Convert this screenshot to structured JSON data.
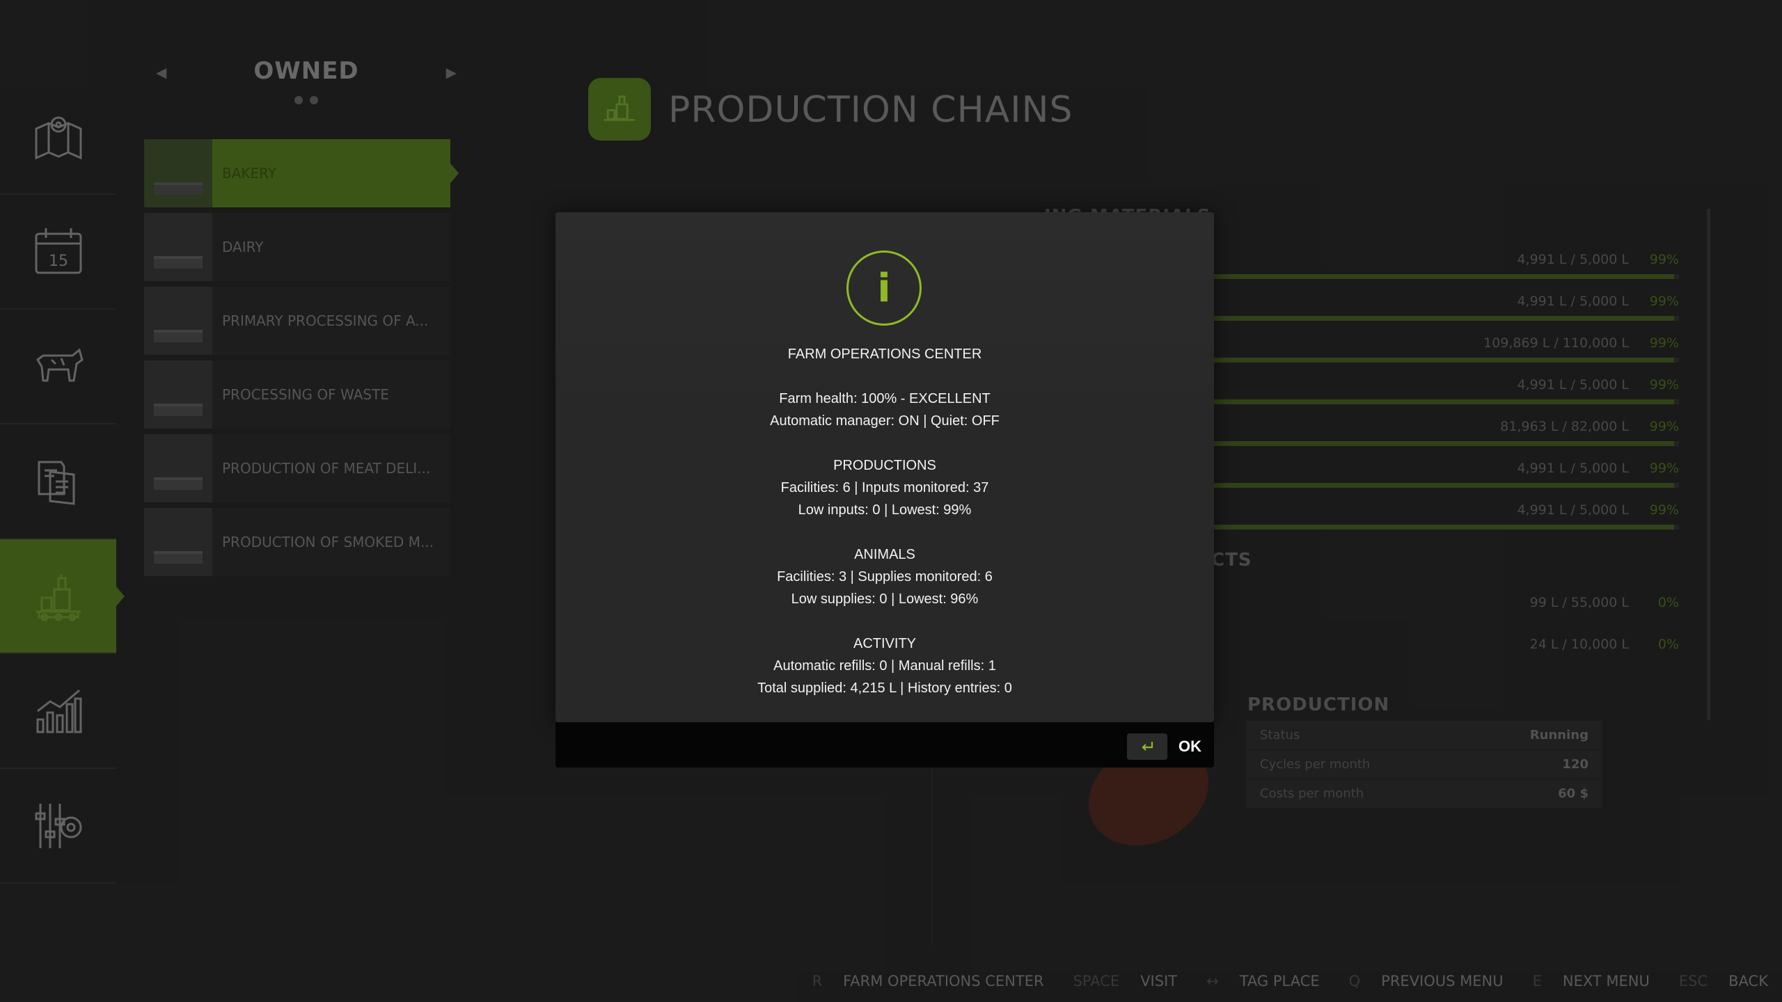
{
  "sidebar": {
    "items": [
      {
        "icon": "map-pin-icon",
        "active": false
      },
      {
        "icon": "calendar-icon",
        "active": false
      },
      {
        "icon": "cow-icon",
        "active": false
      },
      {
        "icon": "contracts-icon",
        "active": false
      },
      {
        "icon": "production-icon",
        "active": true
      },
      {
        "icon": "statistics-icon",
        "active": false
      },
      {
        "icon": "settings-icon",
        "active": false
      }
    ]
  },
  "owned": {
    "title": "OWNED",
    "items": [
      {
        "label": "BAKERY",
        "active": true
      },
      {
        "label": "DAIRY",
        "active": false
      },
      {
        "label": "PRIMARY PROCESSING OF A...",
        "active": false
      },
      {
        "label": "PROCESSING OF WASTE",
        "active": false
      },
      {
        "label": "PRODUCTION OF MEAT DELI...",
        "active": false
      },
      {
        "label": "PRODUCTION OF SMOKED M...",
        "active": false
      }
    ]
  },
  "page": {
    "title": "PRODUCTION CHAINS",
    "materials_head": "ING MATERIALS",
    "products_head": "CTS",
    "materials": [
      {
        "amount": "4,991 L / 5,000 L",
        "pct": "99%",
        "fill": 0.99
      },
      {
        "amount": "4,991 L / 5,000 L",
        "pct": "99%",
        "fill": 0.99
      },
      {
        "amount": "109,869 L / 110,000 L",
        "pct": "99%",
        "fill": 0.99
      },
      {
        "amount": "4,991 L / 5,000 L",
        "pct": "99%",
        "fill": 0.99
      },
      {
        "amount": "81,963 L / 82,000 L",
        "pct": "99%",
        "fill": 0.99
      },
      {
        "amount": "4,991 L / 5,000 L",
        "pct": "99%",
        "fill": 0.99
      },
      {
        "amount": "4,991 L / 5,000 L",
        "pct": "99%",
        "fill": 0.99
      }
    ],
    "products": [
      {
        "amount": "99 L / 55,000 L",
        "pct": "0%"
      },
      {
        "amount": "24 L / 10,000 L",
        "pct": "0%"
      }
    ],
    "production": {
      "title": "PRODUCTION",
      "rows": [
        {
          "label": "Status",
          "value": "Running"
        },
        {
          "label": "Cycles per month",
          "value": "120"
        },
        {
          "label": "Costs per month",
          "value": "60 $"
        }
      ]
    }
  },
  "modal": {
    "title": "FARM OPERATIONS CENTER",
    "line_health": "Farm health: 100% - EXCELLENT",
    "line_manager": "Automatic manager: ON | Quiet: OFF",
    "productions_head": "PRODUCTIONS",
    "productions_line1": "Facilities: 6 | Inputs monitored: 37",
    "productions_line2": "Low inputs: 0 | Lowest: 99%",
    "animals_head": "ANIMALS",
    "animals_line1": "Facilities: 3 | Supplies monitored: 6",
    "animals_line2": "Low supplies: 0 | Lowest: 96%",
    "activity_head": "ACTIVITY",
    "activity_line1": "Automatic refills: 0 | Manual refills: 1",
    "activity_line2": "Total supplied: 4,215 L | History entries: 0",
    "ok_label": "OK"
  },
  "hints": [
    {
      "key": "R",
      "text": "FARM OPERATIONS CENTER"
    },
    {
      "key": "SPACE",
      "text": "VISIT"
    },
    {
      "key": "↔",
      "text": "TAG PLACE"
    },
    {
      "key": "Q",
      "text": "PREVIOUS MENU"
    },
    {
      "key": "E",
      "text": "NEXT MENU"
    },
    {
      "key": "ESC",
      "text": "BACK"
    }
  ],
  "colors": {
    "accent": "#8fba26",
    "active_bg": "#3f5a18"
  }
}
